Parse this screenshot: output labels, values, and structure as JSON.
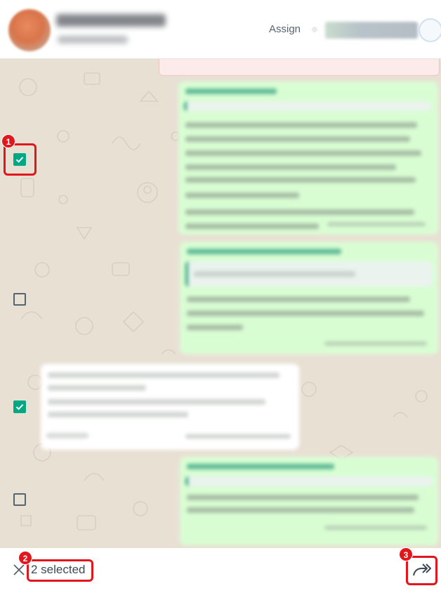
{
  "header": {
    "assign_label": "Assign"
  },
  "selection": {
    "count_label": "2 selected",
    "selected_count": 2
  },
  "annotations": [
    "1",
    "2",
    "3"
  ],
  "icons": {
    "close": "close-icon",
    "forward": "forward-icon",
    "check": "checkmark-icon"
  },
  "colors": {
    "accent": "#00a884",
    "annotation": "#e0171c",
    "outgoing_bubble": "#d9fdd3",
    "chat_background": "#e9e0d4"
  },
  "messages": [
    {
      "direction": "outgoing",
      "selected": true
    },
    {
      "direction": "outgoing",
      "selected": false
    },
    {
      "direction": "incoming",
      "selected": true
    },
    {
      "direction": "outgoing",
      "selected": false
    }
  ]
}
